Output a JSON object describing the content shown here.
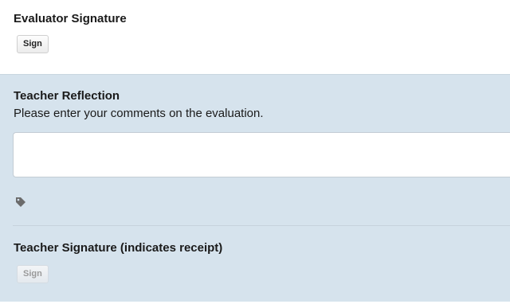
{
  "evaluator_signature": {
    "title": "Evaluator Signature",
    "sign_label": "Sign"
  },
  "teacher_reflection": {
    "title": "Teacher Reflection",
    "instructions": "Please enter your comments on the evaluation.",
    "comment_value": "",
    "tag_icon": "tag-icon"
  },
  "teacher_signature": {
    "title": "Teacher Signature (indicates receipt)",
    "sign_label": "Sign",
    "sign_enabled": false
  },
  "colors": {
    "panel_background": "#d6e3ed",
    "page_background": "#ffffff"
  }
}
